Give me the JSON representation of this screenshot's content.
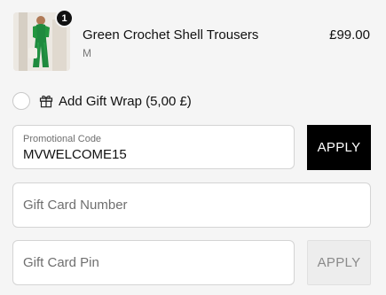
{
  "cart_item": {
    "quantity": "1",
    "name": "Green Crochet Shell Trousers",
    "variant": "M",
    "price": "£99.00"
  },
  "gift_wrap": {
    "label": "Add Gift Wrap (5,00 £)",
    "checked": false
  },
  "promo": {
    "label": "Promotional Code",
    "value": "MVWELCOME15",
    "apply_label": "APPLY"
  },
  "gift_card": {
    "number_placeholder": "Gift Card Number",
    "pin_placeholder": "Gift Card Pin",
    "apply_label": "APPLY"
  },
  "icons": {
    "gift": "gift-icon",
    "product_image": "product-thumbnail"
  },
  "colors": {
    "background": "#f5f5f5",
    "primary_button": "#000000",
    "disabled_button": "#ededed",
    "product_green": "#1f8a3e"
  }
}
